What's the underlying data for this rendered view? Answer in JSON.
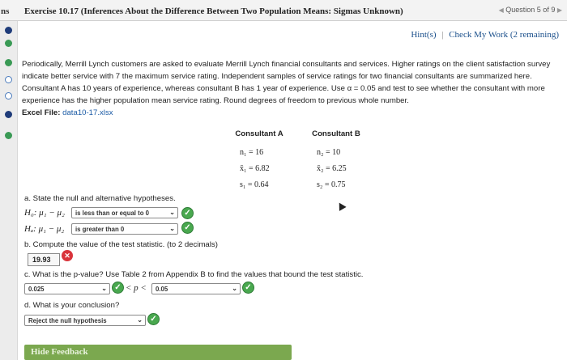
{
  "header": {
    "left_fragment": "ns",
    "title": "Exercise 10.17 (Inferences About the Difference Between Two Population Means: Sigmas Unknown)",
    "question_nav": "Question 5 of 9"
  },
  "links": {
    "hints": "Hint(s)",
    "separator": "|",
    "check_work": "Check My Work (2 remaining)"
  },
  "prompt": {
    "line1": "Periodically, Merrill Lynch customers are asked to evaluate Merrill Lynch financial consultants and services. Higher ratings on the client satisfaction survey",
    "line2": "indicate better service with 7 the maximum service rating. Independent samples of service ratings for two financial consultants are summarized here.",
    "line3": "Consultant A has 10 years of experience, whereas consultant B has 1 year of experience. Use α = 0.05 and test to see whether the consultant with more",
    "line4": "experience has the higher population mean service rating. Round degrees of freedom to previous whole number.",
    "excel_label": "Excel File:",
    "excel_file": "data10-17.xlsx"
  },
  "stats": {
    "a_header": "Consultant A",
    "b_header": "Consultant B",
    "a_n": "n₁ = 16",
    "a_mean": "x̄₁ = 6.82",
    "a_s": "s₁ = 0.64",
    "b_n": "n₂ = 10",
    "b_mean": "x̄₂ = 6.25",
    "b_s": "s₂ = 0.75"
  },
  "part_a": {
    "label": "a. State the null and alternative hypotheses.",
    "h0_text": "H₀: μ₁ − μ₂",
    "h0_select": "is less than or equal to 0",
    "ha_text": "Hₐ: μ₁ − μ₂",
    "ha_select": "is greater than 0"
  },
  "part_b": {
    "label": "b. Compute the value of the test statistic. (to 2 decimals)",
    "value": "19.93"
  },
  "part_c": {
    "label": "c. What is the p-value? Use Table 2 from Appendix B to find the values that bound the test statistic.",
    "lower_select": "0.025",
    "inequality": "< p <",
    "upper_select": "0.05"
  },
  "part_d": {
    "label": "d. What is your conclusion?",
    "select": "Reject the null hypothesis"
  },
  "footer": {
    "hide_feedback": "Hide Feedback"
  },
  "colors": {
    "correct_green": "#49a84f",
    "incorrect_red": "#d9343b",
    "link_blue": "#1a4f8b",
    "feedback_bar": "#7ba84f"
  }
}
